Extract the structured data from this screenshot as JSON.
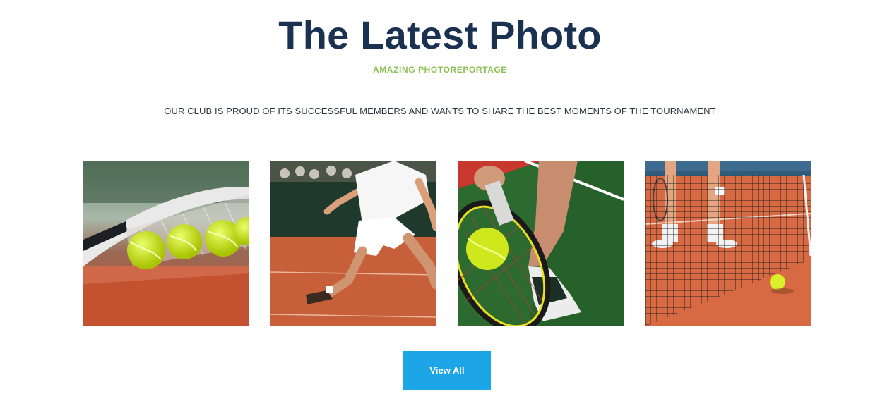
{
  "header": {
    "title": "The Latest Photo",
    "subtitle": "AMAZING PHOTOREPORTAGE",
    "intro": "OUR CLUB IS PROUD OF ITS SUCCESSFUL MEMBERS AND WANTS TO SHARE THE BEST MOMENTS OF THE TOURNAMENT"
  },
  "gallery": {
    "photos": [
      {
        "subject": "tennis racket with three balls on clay court"
      },
      {
        "subject": "player in white lunging on clay court"
      },
      {
        "subject": "racket hitting ball, player legs on green court"
      },
      {
        "subject": "players at the net, ball on clay court"
      }
    ]
  },
  "actions": {
    "view_all_label": "View All"
  },
  "colors": {
    "title": "#1b3152",
    "subtitle": "#8cc152",
    "button": "#1ca6e8"
  }
}
